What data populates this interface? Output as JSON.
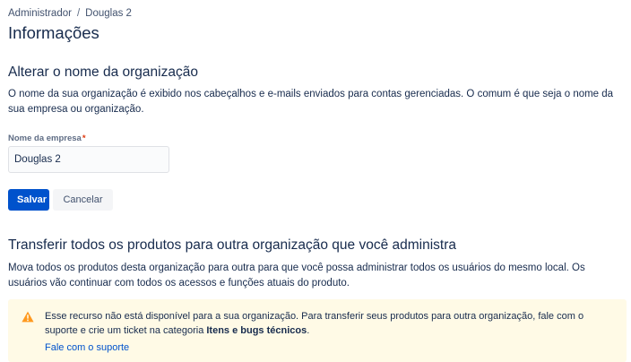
{
  "breadcrumb": {
    "items": [
      "Administrador",
      "Douglas 2"
    ],
    "separator": "/"
  },
  "page_title": "Informações",
  "rename_section": {
    "title": "Alterar o nome da organização",
    "description": "O nome da sua organização é exibido nos cabeçalhos e e-mails enviados para contas gerenciadas. O comum é que seja o nome da sua empresa ou organização.",
    "field_label": "Nome da empresa",
    "required_marker": "*",
    "field_value": "Douglas 2",
    "save_label": "Salvar",
    "cancel_label": "Cancelar"
  },
  "transfer_section": {
    "title": "Transferir todos os produtos para outra organização que você administra",
    "description": "Mova todos os produtos desta organização para outra para que você possa administrar todos os usuários do mesmo local. Os usuários vão continuar com todos os acessos e funções atuais do produto.",
    "warning": {
      "icon": "warning-icon",
      "text_before": "Esse recurso não está disponível para a sua organização. Para transferir seus produtos para outra organização, fale com o suporte e crie um ticket na categoria ",
      "text_bold": "Itens e bugs técnicos",
      "text_after": ".",
      "link_label": "Fale com o suporte"
    }
  },
  "colors": {
    "primary": "#0052CC",
    "warning_bg": "#FFFAE6",
    "warning_icon": "#FF991F",
    "required": "#DE350B"
  }
}
